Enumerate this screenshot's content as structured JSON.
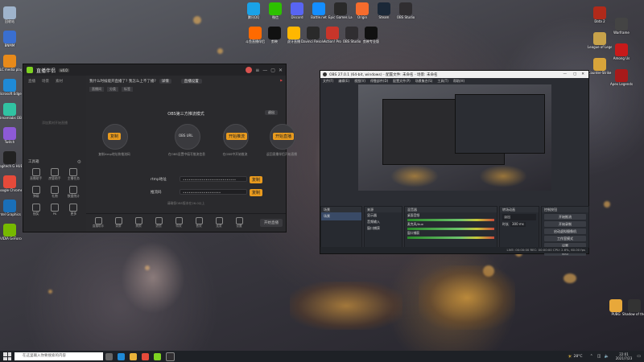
{
  "desktop_left_icons": [
    {
      "label": "回收站",
      "color": "#9fb4cc"
    },
    {
      "label": "BNMM",
      "color": "#3a6fd0"
    },
    {
      "label": "VLC media player",
      "color": "#e88a1a"
    },
    {
      "label": "Microsoft Edge",
      "color": "#1f8ad6"
    },
    {
      "label": "Streamlabs OBS",
      "color": "#31c3a2"
    },
    {
      "label": "Twitch",
      "color": "#8d5ad6"
    },
    {
      "label": "Logitech G HUB",
      "color": "#222"
    },
    {
      "label": "Google Chrome",
      "color": "#e54a3a"
    },
    {
      "label": "Intel Graphics",
      "color": "#1a6fb8"
    },
    {
      "label": "NVIDIA GeForce",
      "color": "#76b900"
    }
  ],
  "desktop_top_icons": [
    {
      "label": "腾讯QQ",
      "color": "#1aa2e8"
    },
    {
      "label": "微信",
      "color": "#2dc100"
    },
    {
      "label": "Discord",
      "color": "#5865f2"
    },
    {
      "label": "Battle.net",
      "color": "#148eff"
    },
    {
      "label": "Epic Games Launcher",
      "color": "#2a2a2a"
    },
    {
      "label": "Origin",
      "color": "#f56c2d"
    },
    {
      "label": "Steam",
      "color": "#1b2838"
    },
    {
      "label": "OBS Studio",
      "color": "#302e31"
    }
  ],
  "desktop_mid_icons": [
    {
      "label": "斗鱼直播伴侣",
      "color": "#ff6a00"
    },
    {
      "label": "剪映",
      "color": "#111"
    },
    {
      "label": "虎牙直播",
      "color": "#ffb700"
    },
    {
      "label": "Davinci Resolve",
      "color": "#2a2a2a"
    },
    {
      "label": "Action! Pro",
      "color": "#c8352a"
    },
    {
      "label": "OBS Studio",
      "color": "#302e31"
    },
    {
      "label": "剪映专业版",
      "color": "#111"
    }
  ],
  "desktop_right_icons": [
    {
      "label": "Dota 2",
      "color": "#b02a1a"
    },
    {
      "label": "Warframe",
      "color": "#444"
    },
    {
      "label": "League of Legends",
      "color": "#c8a24a"
    },
    {
      "label": "Among Us",
      "color": "#c81a1a"
    },
    {
      "label": "Counter-Strike",
      "color": "#d8a43a"
    },
    {
      "label": "Apex Legends",
      "color": "#a81a1a"
    },
    {
      "label": "PUBG",
      "color": "#e8a83a"
    },
    {
      "label": "Shadow of the Tomb Raider",
      "color": "#333"
    }
  ],
  "app1": {
    "title": "直播伴侣",
    "version_badge": "v4.0",
    "sidebar_tabs": [
      "直播",
      "场景",
      "素材"
    ],
    "sidebar_placeholder": "添加素材开始直播",
    "tools_label": "工具箱",
    "tools": [
      "直播助手",
      "房管助手",
      "主播任务",
      "弹幕",
      "礼物",
      "数据统计",
      "抽奖",
      "PK",
      "更多"
    ],
    "notice": "我什么时候能开直播了? 我怎么上不了播?",
    "notice_btn": "详情",
    "top_tab_active": "直播设置",
    "sub_tabs": [
      "直播间",
      "分类",
      "标签"
    ],
    "section_title": "OBS第三方推流模式",
    "section_btn": "退出",
    "steps": [
      {
        "label": "复制rtmp地址和推流码"
      },
      {
        "label": "在OBS设置中填写推流信息"
      },
      {
        "label": "在OBS中开始推流"
      },
      {
        "label": "返回直播伴侣开始直播"
      }
    ],
    "step_tags": [
      "复制",
      "OBS URL",
      "开始推流",
      "开始直播"
    ],
    "rtmp_label": "rtmp地址",
    "rtmp_value": "••••••••••••••••••••••••••••",
    "key_label": "推流码",
    "key_value": "••••••••••••••••••••",
    "copy_btn": "复制",
    "hint": "请确保OBS版本在26.0以上",
    "bottom_tools": [
      "直播助手",
      "录屏",
      "美颜",
      "滤镜",
      "特效",
      "音效",
      "连麦",
      "设置"
    ],
    "start_btn": "开始直播"
  },
  "app2": {
    "title": "OBS 27.0.1 (64-bit, windows) - 配置文件: 未命名 - 场景: 未命名",
    "menus": [
      "文件(F)",
      "编辑(E)",
      "视图(V)",
      "停靠部件(D)",
      "配置文件(P)",
      "场景集合(S)",
      "工具(T)",
      "帮助(H)"
    ],
    "docks": {
      "scenes": {
        "title": "场景",
        "items": [
          "场景"
        ]
      },
      "sources": {
        "title": "来源",
        "items": [
          "显示器",
          "音频输入",
          "窗口捕获"
        ]
      },
      "mixer": {
        "title": "混音器",
        "channels": [
          "桌面音频",
          "麦克风/Aux",
          "窗口捕获"
        ],
        "level": "0.0 dB"
      },
      "transitions": {
        "title": "转场动画",
        "type": "淡出",
        "duration_label": "时长",
        "duration": "300 ms"
      },
      "controls": {
        "title": "控制按钮",
        "buttons": [
          "开始推流",
          "开始录制",
          "启动虚拟摄像机",
          "工作室模式",
          "设置",
          "退出"
        ]
      }
    },
    "status": "LIVE: 00:00:00  REC: 00:00:00  CPU: 2.6%, 60.00 fps"
  },
  "taskbar": {
    "search_placeholder": "在这里输入你要搜索的内容",
    "weather": "28°C",
    "time": "22:01",
    "date": "2021/7/23"
  }
}
